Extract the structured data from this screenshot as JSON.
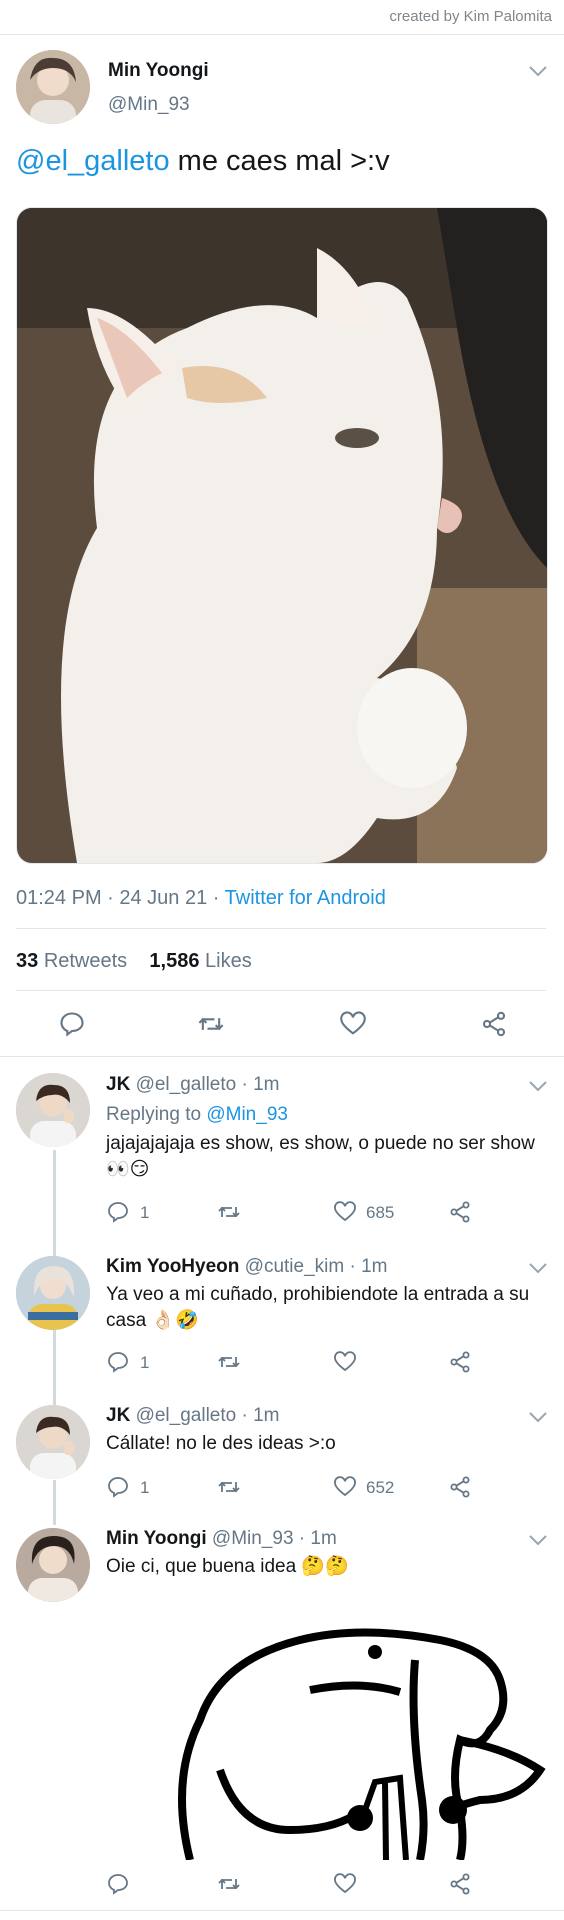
{
  "credit": "created by Kim Palomita",
  "main_tweet": {
    "author_name": "Min Yoongi",
    "author_handle": "@Min_93",
    "mention": "@el_galleto",
    "text": " me caes mal >:v",
    "time": "01:24 PM · 24 Jun 21 · ",
    "source": "Twitter for Android",
    "retweets_count": "33",
    "retweets_label": "Retweets",
    "likes_count": "1,586",
    "likes_label": "Likes"
  },
  "replies": [
    {
      "name": "JK",
      "meta": "@el_galleto · 1m",
      "replying_label": "Replying to ",
      "replying_to": "@Min_93",
      "text": "jajajajajaja es show, es show, o puede no ser show 👀😏",
      "reply_count": "1",
      "like_count": "685"
    },
    {
      "name": "Kim YooHyeon",
      "meta": "@cutie_kim · 1m",
      "text": "Ya veo a mi cuñado, prohibiendote la entrada a su casa 👌🏻🤣",
      "reply_count": "1",
      "like_count": ""
    },
    {
      "name": "JK",
      "meta": "@el_galleto · 1m",
      "text": "Cállate! no le des ideas >:o",
      "reply_count": "1",
      "like_count": "652"
    },
    {
      "name": "Min Yoongi",
      "meta": "@Min_93 · 1m",
      "text": "Oie ci, que buena idea 🤔🤔",
      "reply_count": "",
      "like_count": ""
    }
  ],
  "icons": [
    "reply-icon",
    "retweet-icon",
    "like-icon",
    "share-icon",
    "chevron-down-icon"
  ]
}
